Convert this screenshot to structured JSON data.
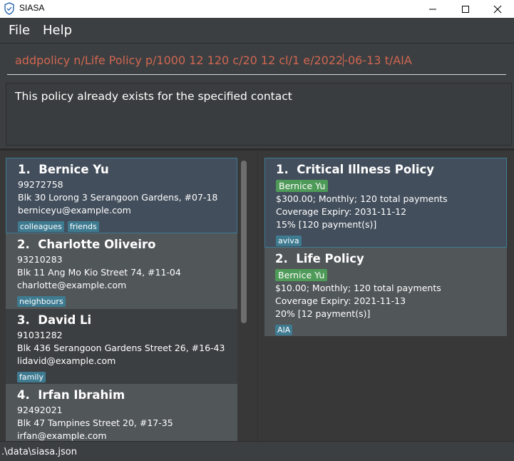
{
  "window": {
    "title": "SIASA",
    "icons": {
      "app": "shield-icon",
      "minimize": "minimize-icon",
      "maximize": "maximize-icon",
      "close": "close-icon"
    }
  },
  "menu": {
    "file": "File",
    "help": "Help"
  },
  "command": {
    "value_before_caret": "addpolicy n/Life Policy p/1000 12 120 c/20 12 cl/1 e/2022",
    "value_after_caret": "-06-13 t/AIA"
  },
  "result": {
    "message": "This policy already exists for the specified contact"
  },
  "persons": [
    {
      "index": "1.",
      "name": "Bernice Yu",
      "phone": "99272758",
      "address": "Blk 30 Lorong 3 Serangoon Gardens, #07-18",
      "email": "berniceyu@example.com",
      "tags": [
        "colleagues",
        "friends"
      ]
    },
    {
      "index": "2.",
      "name": "Charlotte Oliveiro",
      "phone": "93210283",
      "address": "Blk 11 Ang Mo Kio Street 74, #11-04",
      "email": "charlotte@example.com",
      "tags": [
        "neighbours"
      ]
    },
    {
      "index": "3.",
      "name": "David Li",
      "phone": "91031282",
      "address": "Blk 436 Serangoon Gardens Street 26, #16-43",
      "email": "lidavid@example.com",
      "tags": [
        "family"
      ]
    },
    {
      "index": "4.",
      "name": "Irfan Ibrahim",
      "phone": "92492021",
      "address": "Blk 47 Tampines Street 20, #17-35",
      "email": "irfan@example.com",
      "tags": []
    }
  ],
  "policies": [
    {
      "index": "1.",
      "name": "Critical Illness Policy",
      "owner": "Bernice Yu",
      "payment": "$300.00; Monthly; 120 total payments",
      "expiry": "Coverage Expiry: 2031-11-12",
      "commission": "15% [120 payment(s)]",
      "tag": "aviva"
    },
    {
      "index": "2.",
      "name": "Life Policy",
      "owner": "Bernice Yu",
      "payment": "$10.00; Monthly; 120 total payments",
      "expiry": "Coverage Expiry: 2021-11-13",
      "commission": "20% [12 payment(s)]",
      "tag": "AIA"
    }
  ],
  "status": {
    "path": ".\\data\\siasa.json"
  },
  "colors": {
    "background": "#3c3f41",
    "command_text": "#d06651",
    "tag": "#3e7b91",
    "owner_tag": "#4e9a58",
    "selected_card": "#434e5c"
  }
}
